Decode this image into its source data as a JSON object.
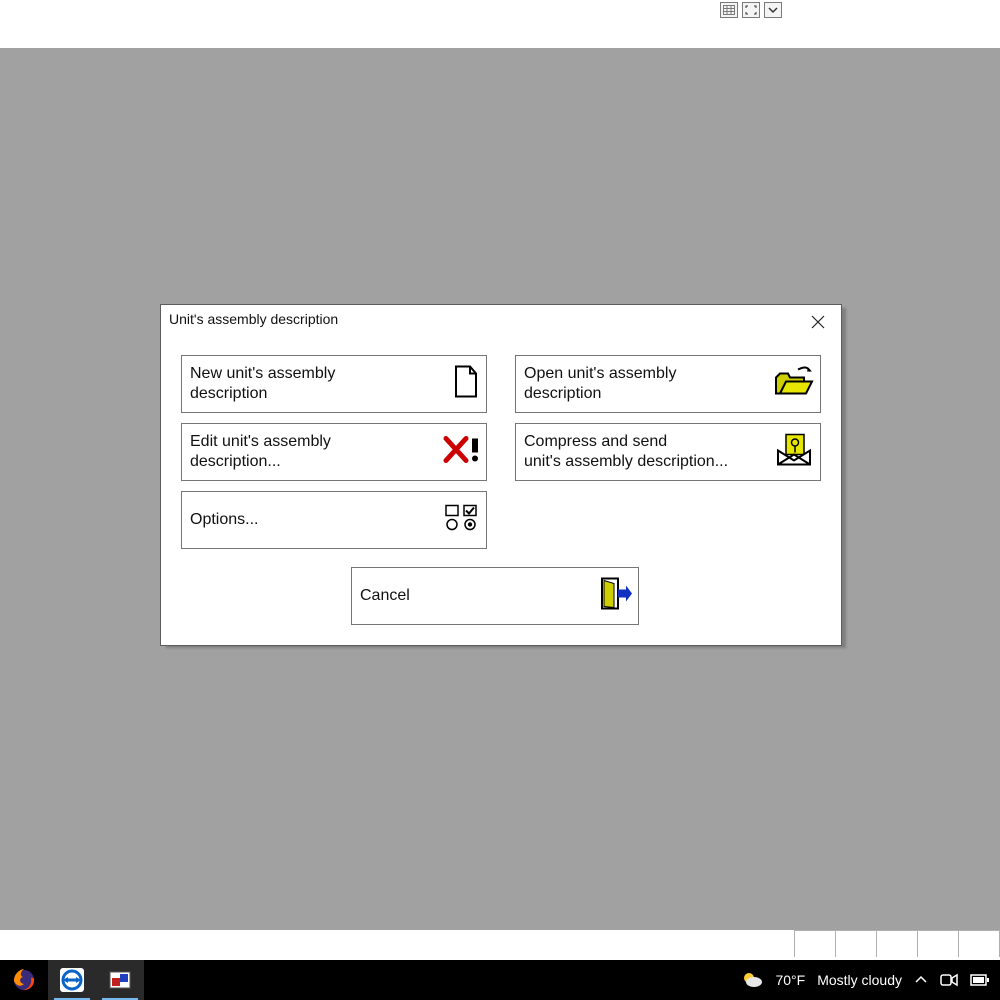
{
  "dialog": {
    "title": "Unit's assembly description",
    "buttons": {
      "new": "New unit's assembly\ndescription",
      "open": "Open unit's assembly\ndescription",
      "edit": "Edit unit's assembly\ndescription...",
      "compress": "Compress and send\nunit's assembly description...",
      "options": "Options...",
      "cancel": "Cancel"
    }
  },
  "weather": {
    "temp": "70°F",
    "cond": "Mostly cloudy"
  }
}
